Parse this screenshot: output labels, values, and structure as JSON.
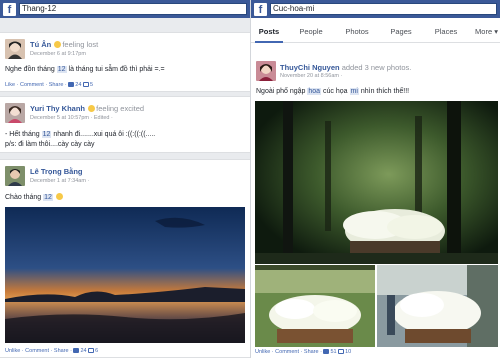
{
  "left": {
    "search_value": "Thang-12",
    "posts": [
      {
        "name": "Tú Ân",
        "status": "feeling lost",
        "meta": "December 6 at 9:17pm",
        "text_before": "Nghe đồn tháng ",
        "highlight": "12",
        "text_after": " là tháng tui sẫm đồ thì phải =.=",
        "actions": "Like · Comment · Share ·",
        "likes": "24",
        "comments": "5"
      },
      {
        "name": "Yuri Thy Khanh",
        "status": "feeling excited",
        "meta": "December 5 at 10:57pm · Edited ·",
        "line1_before": "- Hết tháng ",
        "highlight": "12",
        "line1_after": " nhanh đi.......xui quá ôi :((:((:((.....",
        "line2": "p/s: đi làm thôi....cày cày cày",
        "actions": "Like · Comment · Share"
      },
      {
        "name": "Lê Trọng Bằng",
        "meta": "December 1 at 7:34am ·",
        "text_before": "Chào tháng ",
        "highlight": "12",
        "actions": "Unlike · Comment · Share ·",
        "likes": "24",
        "comments": "6"
      }
    ]
  },
  "right": {
    "search_value": "Cuc-hoa-mi",
    "tabs": [
      "Posts",
      "People",
      "Photos",
      "Pages",
      "Places",
      "More ▾"
    ],
    "post": {
      "name": "ThuyChi Nguyen",
      "added": "added 3 new photos.",
      "meta": "November 20 at 8:56am ·",
      "t1": "Ngoài phố ngập ",
      "h1": "hoa",
      "t2": " cúc họa ",
      "h2": "mi",
      "t3": " nhìn thích thế!!!",
      "actions": "Unlike · Comment · Share ·",
      "likes": "51",
      "comments": "10"
    }
  },
  "colors": {
    "brand": "#3b5998",
    "link": "#365899",
    "highlight_bg": "#dce4f2"
  }
}
